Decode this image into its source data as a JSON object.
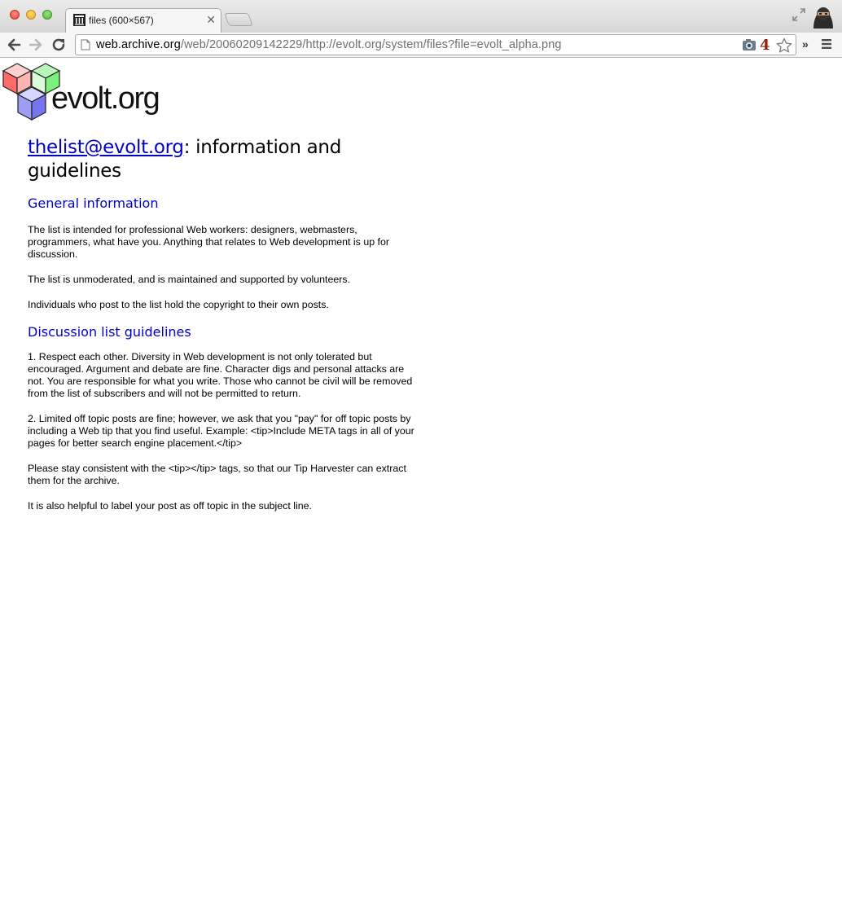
{
  "browser": {
    "tab": {
      "title": "files (600×567)"
    },
    "address_bar": {
      "host": "web.archive.org",
      "path": "/web/20060209142229/http://evolt.org/system/files?file=evolt_alpha.png"
    },
    "extension_badge": "4",
    "icons": {
      "favicon": "archive-columns-icon",
      "back": "back-arrow-icon",
      "forward": "forward-arrow-icon",
      "reload": "reload-icon",
      "page": "document-page-icon",
      "extension": "camera-extension-icon",
      "bookmark": "star-icon",
      "menu": "hamburger-menu-icon",
      "fullscreen": "fullscreen-arrows-icon",
      "profile": "ninja-avatar-icon"
    },
    "overflow_label": "»"
  },
  "page": {
    "logo_text": "evolt.org",
    "logo_colors": {
      "red": "#ff6b6b",
      "green": "#7bf07b",
      "blue": "#7575f0"
    },
    "title_link": "thelist@evolt.org",
    "title_rest": ": information and guidelines",
    "sections": [
      {
        "heading": "General information",
        "paragraphs": [
          "The list is intended for professional Web workers: designers, webmasters, programmers, what have you. Anything that relates to Web development is up for discussion.",
          "The list is unmoderated, and is maintained and supported by volunteers.",
          "Individuals who post to the list hold the copyright to their own posts."
        ]
      },
      {
        "heading": "Discussion list guidelines",
        "paragraphs": [
          "1. Respect each other. Diversity in Web development is not only tolerated but encouraged. Argument and debate are fine. Character digs and personal attacks are not. You are responsible for what you write. Those who cannot be civil will be removed from the list of subscribers and will not be permitted to return.",
          "2. Limited off topic posts are fine; however, we ask that you \"pay\" for off topic posts by including a Web tip that you find useful. Example: <tip>Include META tags in all of your pages for better search engine placement.</tip>",
          "Please stay consistent with the <tip></tip> tags, so that our Tip Harvester can extract them for the archive.",
          "It is also helpful to label your post as off topic in the subject line."
        ]
      }
    ],
    "link_color": "#0000cc"
  }
}
